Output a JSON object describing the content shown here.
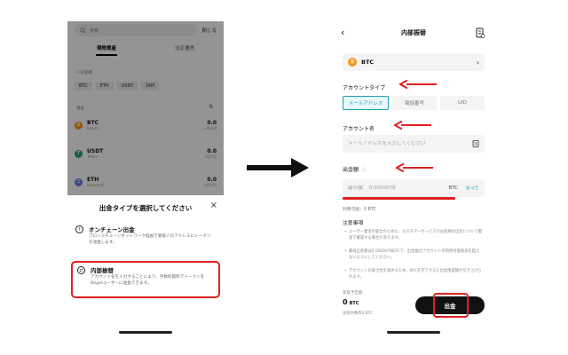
{
  "left": {
    "search_placeholder": "検索",
    "close_label": "閉じる",
    "tabs": [
      {
        "label": "現物資産"
      },
      {
        "label": "法定通貨"
      }
    ],
    "popular_label": "人気銘柄",
    "chips": [
      "BTC",
      "ETH",
      "USDT",
      "XRP"
    ],
    "list_label": "資産",
    "coins": [
      {
        "symbol": "BTC",
        "name": "Bitcoin",
        "amount": "0.0",
        "usd": "≈¥0.00",
        "color": "#f7931a",
        "glyph": "₿"
      },
      {
        "symbol": "USDT",
        "name": "Tether",
        "amount": "0.0",
        "usd": "≈¥0.00",
        "color": "#26a17b",
        "glyph": "T"
      },
      {
        "symbol": "ETH",
        "name": "Ethereum",
        "amount": "0.0",
        "usd": "≈¥0.00",
        "color": "#627eea",
        "glyph": "Ξ"
      }
    ],
    "sheet": {
      "title": "出金タイプを選択してください",
      "options": [
        {
          "title": "オンチェーン出金",
          "desc": "ブロックチェーンネットワーク経由で受取人のアドレスにトークンを送金します。"
        },
        {
          "title": "内部振替",
          "desc": "アカウント名を入力することにより、手数料無料でトークンをBitgetユーザーに送金できます。"
        }
      ]
    }
  },
  "right": {
    "title": "内部振替",
    "coin": {
      "symbol": "BTC",
      "color": "#f7931a",
      "glyph": "₿"
    },
    "account_type_label": "アカウントタイプ",
    "account_types": [
      {
        "label": "メールアドレス",
        "active": true
      },
      {
        "label": "電話番号",
        "active": false
      },
      {
        "label": "UID",
        "active": false
      }
    ],
    "account_name_label": "アカウント名",
    "account_name_placeholder": "メールアドレスを入力してください",
    "amount_label": "出金額",
    "amount_placeholder": "最小額： 0.0000078",
    "amount_unit": "BTC",
    "all_label": "すべて",
    "fee_text": "利用可能：0 BTC",
    "notes_title": "注意事項",
    "notes": [
      "ユーザー資金の安全のために、カスタマーサービスがお客様の出金について電話で確認する場合があります。",
      "最低出金額は0.0000078BTCで、出金額がアカウントの利用可能残高を超えないようにしてください。",
      "アカウントの安全性を高めるため、KYCを完了すると出金限度額が引き上げられます。"
    ],
    "receive_label": "受取予定額",
    "receive_amount": "0",
    "receive_unit": "BTC",
    "fee_label": "送金手数料0 BTC",
    "withdraw_label": "出金"
  },
  "colors": {
    "highlight": "#e02020",
    "accent": "#1aa0b2"
  }
}
